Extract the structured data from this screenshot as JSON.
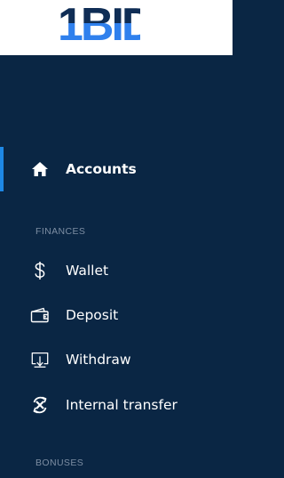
{
  "brand": {
    "logo_text": "1BID",
    "colors": {
      "logo_dark": "#0f2d55",
      "logo_blue": "#2f80ed"
    }
  },
  "colors": {
    "sidebar_bg": "#0a2644",
    "active_indicator": "#1e88e5",
    "section_title": "#7d8ea3",
    "item_text": "#ffffff"
  },
  "sidebar": {
    "primary": [
      {
        "label": "Accounts",
        "icon": "home-icon",
        "active": true
      }
    ],
    "sections": [
      {
        "title": "FINANCES",
        "items": [
          {
            "label": "Wallet",
            "icon": "dollar-icon"
          },
          {
            "label": "Deposit",
            "icon": "wallet-icon"
          },
          {
            "label": "Withdraw",
            "icon": "withdraw-icon"
          },
          {
            "label": "Internal transfer",
            "icon": "transfer-icon"
          }
        ]
      },
      {
        "title": "BONUSES",
        "items": []
      }
    ]
  }
}
